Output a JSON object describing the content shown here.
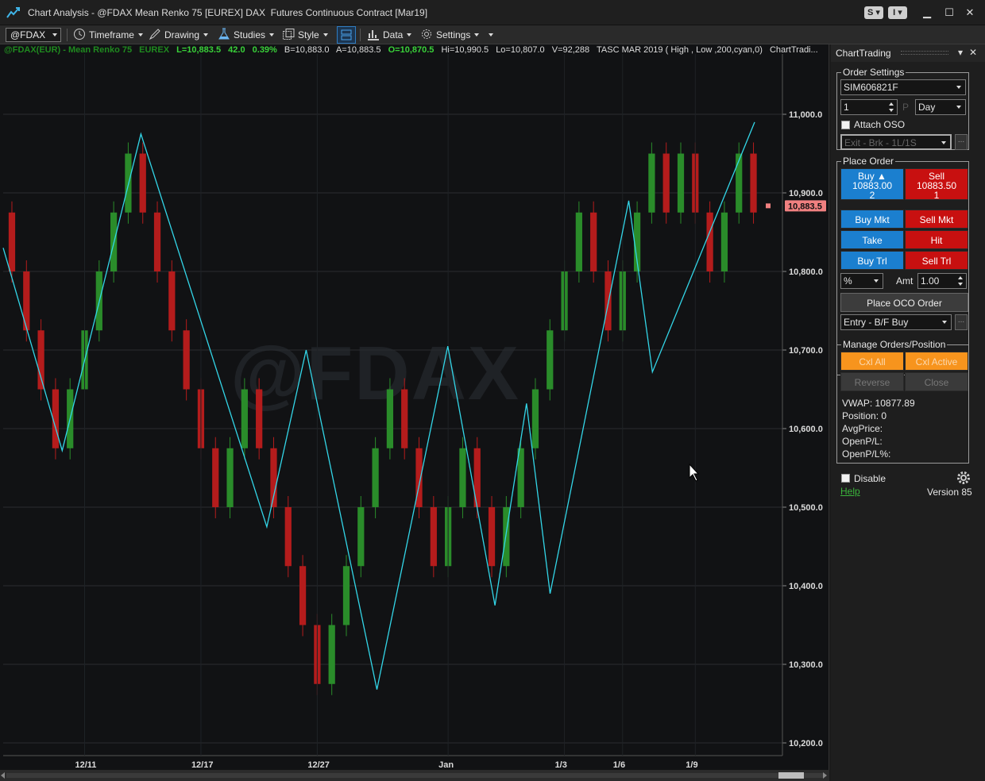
{
  "window": {
    "title": "Chart Analysis - @FDAX Mean Renko 75 [EUREX] DAX  Futures Continuous Contract [Mar19]",
    "btn_s": "S",
    "btn_i": "I",
    "minimize": "▁",
    "maximize": "☐",
    "close": "✕"
  },
  "toolbar": {
    "symbol": "@FDAX",
    "timeframe": "Timeframe",
    "drawing": "Drawing",
    "studies": "Studies",
    "style": "Style",
    "data": "Data",
    "settings": "Settings"
  },
  "info_bar": {
    "symbol": "@FDAX(EUR) - Mean Renko 75",
    "exchange": "EUREX",
    "last": "L=10,883.5",
    "change": "42.0",
    "pct": "0.39%",
    "bid": "B=10,883.0",
    "ask": "A=10,883.5",
    "open": "O=10,870.5",
    "high": "Hi=10,990.5",
    "low": "Lo=10,807.0",
    "volume": "V=92,288",
    "study": "TASC MAR 2019 ( High , Low ,200,cyan,0)",
    "chart_trading": "ChartTradi..."
  },
  "watermark": "@FDAX",
  "colors": {
    "up": "#2a8c2a",
    "down": "#b41c1c",
    "zigzag": "#33d6e8",
    "last_price_tag": "#f08080",
    "background": "#111214"
  },
  "chart_data": {
    "type": "candlestick",
    "instrument": "@FDAX",
    "bar_type": "Mean Renko 75",
    "yticks": [
      "11,000.0",
      "10,900.0",
      "10,800.0",
      "10,700.0",
      "10,600.0",
      "10,500.0",
      "10,400.0",
      "10,300.0",
      "10,200.0"
    ],
    "ylim": [
      10200,
      11000
    ],
    "last_price": "10,883.5",
    "xticks": [
      "12/11",
      "12/17",
      "12/27",
      "Jan",
      "1/3",
      "1/6",
      "1/9"
    ],
    "bricks": [
      {
        "o": 10800,
        "c": 10875,
        "d": "dn"
      },
      {
        "o": 10800,
        "c": 10725,
        "d": "dn"
      },
      {
        "o": 10725,
        "c": 10650,
        "d": "dn"
      },
      {
        "o": 10650,
        "c": 10575,
        "d": "dn"
      },
      {
        "o": 10575,
        "c": 10650,
        "d": "up"
      },
      {
        "o": 10650,
        "c": 10725,
        "d": "up"
      },
      {
        "o": 10725,
        "c": 10800,
        "d": "up"
      },
      {
        "o": 10800,
        "c": 10875,
        "d": "up"
      },
      {
        "o": 10875,
        "c": 10950,
        "d": "up"
      },
      {
        "o": 10950,
        "c": 10875,
        "d": "dn"
      },
      {
        "o": 10875,
        "c": 10800,
        "d": "dn"
      },
      {
        "o": 10800,
        "c": 10725,
        "d": "dn"
      },
      {
        "o": 10725,
        "c": 10650,
        "d": "dn"
      },
      {
        "o": 10650,
        "c": 10575,
        "d": "dn"
      },
      {
        "o": 10575,
        "c": 10500,
        "d": "dn"
      },
      {
        "o": 10500,
        "c": 10575,
        "d": "up"
      },
      {
        "o": 10575,
        "c": 10650,
        "d": "up"
      },
      {
        "o": 10650,
        "c": 10575,
        "d": "dn"
      },
      {
        "o": 10575,
        "c": 10500,
        "d": "dn"
      },
      {
        "o": 10500,
        "c": 10425,
        "d": "dn"
      },
      {
        "o": 10425,
        "c": 10350,
        "d": "dn"
      },
      {
        "o": 10350,
        "c": 10275,
        "d": "dn"
      },
      {
        "o": 10275,
        "c": 10350,
        "d": "up"
      },
      {
        "o": 10350,
        "c": 10425,
        "d": "up"
      },
      {
        "o": 10425,
        "c": 10500,
        "d": "up"
      },
      {
        "o": 10500,
        "c": 10575,
        "d": "up"
      },
      {
        "o": 10575,
        "c": 10650,
        "d": "up"
      },
      {
        "o": 10650,
        "c": 10575,
        "d": "dn"
      },
      {
        "o": 10575,
        "c": 10500,
        "d": "dn"
      },
      {
        "o": 10500,
        "c": 10425,
        "d": "dn"
      },
      {
        "o": 10425,
        "c": 10500,
        "d": "up"
      },
      {
        "o": 10500,
        "c": 10575,
        "d": "up"
      },
      {
        "o": 10575,
        "c": 10500,
        "d": "dn"
      },
      {
        "o": 10500,
        "c": 10425,
        "d": "dn"
      },
      {
        "o": 10425,
        "c": 10500,
        "d": "up"
      },
      {
        "o": 10500,
        "c": 10575,
        "d": "up"
      },
      {
        "o": 10575,
        "c": 10650,
        "d": "up"
      },
      {
        "o": 10650,
        "c": 10725,
        "d": "up"
      },
      {
        "o": 10725,
        "c": 10800,
        "d": "up"
      },
      {
        "o": 10800,
        "c": 10875,
        "d": "up"
      },
      {
        "o": 10875,
        "c": 10800,
        "d": "dn"
      },
      {
        "o": 10800,
        "c": 10725,
        "d": "dn"
      },
      {
        "o": 10725,
        "c": 10800,
        "d": "up"
      },
      {
        "o": 10800,
        "c": 10875,
        "d": "up"
      },
      {
        "o": 10875,
        "c": 10950,
        "d": "up"
      },
      {
        "o": 10950,
        "c": 10875,
        "d": "dn"
      },
      {
        "o": 10875,
        "c": 10950,
        "d": "up"
      },
      {
        "o": 10950,
        "c": 10875,
        "d": "dn"
      },
      {
        "o": 10875,
        "c": 10800,
        "d": "dn"
      },
      {
        "o": 10800,
        "c": 10875,
        "d": "up"
      },
      {
        "o": 10875,
        "c": 10950,
        "d": "up"
      },
      {
        "o": 10950,
        "c": 10875,
        "d": "dn"
      }
    ],
    "zigzag": [
      {
        "t": 0,
        "v": 10830
      },
      {
        "t": 7.5,
        "v": 10572
      },
      {
        "t": 17.5,
        "v": 10975
      },
      {
        "t": 33.5,
        "v": 10475
      },
      {
        "t": 38.5,
        "v": 10700
      },
      {
        "t": 47.5,
        "v": 10268
      },
      {
        "t": 56.5,
        "v": 10705
      },
      {
        "t": 62.5,
        "v": 10375
      },
      {
        "t": 66.5,
        "v": 10632
      },
      {
        "t": 69.5,
        "v": 10390
      },
      {
        "t": 79.5,
        "v": 10890
      },
      {
        "t": 82.5,
        "v": 10672
      },
      {
        "t": 95.5,
        "v": 10990
      }
    ]
  },
  "panel": {
    "title": "ChartTrading",
    "order_settings": {
      "legend": "Order Settings",
      "account": "SIM606821F",
      "quantity": "1",
      "p_label": "P",
      "tif": "Day",
      "attach_oso": "Attach OSO",
      "oso_strategy": "Exit - Brk - 1L/1S",
      "ellipsis": "..."
    },
    "place_order": {
      "legend": "Place Order",
      "buy_label": "Buy ▲",
      "buy_price": "10883.00",
      "buy_size": "2",
      "sell_label": "Sell",
      "sell_price": "10883.50",
      "sell_size": "1",
      "buy_mkt": "Buy Mkt",
      "sell_mkt": "Sell Mkt",
      "take": "Take",
      "hit": "Hit",
      "buy_trl": "Buy Trl",
      "sell_trl": "Sell Trl",
      "trail_unit": "%",
      "amt_label": "Amt",
      "amt_value": "1.00",
      "place_oco": "Place OCO Order",
      "entry_strategy": "Entry - B/F Buy",
      "ellipsis": "..."
    },
    "manage": {
      "legend": "Manage Orders/Position",
      "cxl_all": "Cxl All",
      "cxl_active": "Cxl Active",
      "reverse": "Reverse",
      "close": "Close",
      "vwap": "VWAP:  10877.89",
      "position": "Position:  0",
      "avg_price": "AvgPrice:",
      "open_pl": "OpenP/L:",
      "open_pl_pct": "OpenP/L%:"
    },
    "disable": "Disable",
    "help": "Help",
    "version": "Version 85"
  }
}
